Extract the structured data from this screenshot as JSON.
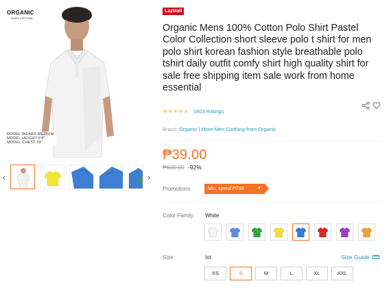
{
  "gallery": {
    "brand_logo": "ORGANIC",
    "brand_logo_sub": "100% COTTON",
    "model_info": [
      "MODEL WEARS MEDIUM",
      "MODEL HEIGHT 5'8\"",
      "MODEL CHEST 39\""
    ],
    "prev_arrow": "‹",
    "next_arrow": "›",
    "thumbnails": [
      {
        "color": "#f4f4f4",
        "active": true
      },
      {
        "color": "#f2e634",
        "active": false
      },
      {
        "color": "#3f7fd1",
        "active": false
      },
      {
        "color": "#3f7fd1",
        "active": false
      },
      {
        "color": "#3f7fd1",
        "active": false
      }
    ]
  },
  "product": {
    "badge": "LazMall",
    "title": "Organic Mens 100% Cotton Polo Shirt Pastel Color Collection short sleeve polo t shirt for men polo shirt korean fashion style breathable polo tshirt daily outfit comfy shirt high quality shirt for sale free shipping item sale work from home essential",
    "rating_stars": 4.5,
    "ratings_text": "1603 Ratings",
    "brand_label": "Brand:",
    "brand_name": "Organic",
    "brand_more": "| More Men Clothing from Organic",
    "price": "₱39.00",
    "original_price": "₱600.00",
    "discount": "-92%"
  },
  "promotions": {
    "label": "Promotions",
    "badge": "Min. spend ₱299",
    "caret": "▼"
  },
  "color_family": {
    "label": "Color Family",
    "selected": "White",
    "swatches": [
      "#f4f4f4",
      "#5a8fd6",
      "#2faa3c",
      "#f0e03a",
      "#2f7fd8",
      "#d42a2a",
      "#9b3fc0",
      "#f0a030"
    ],
    "selected_index": 4
  },
  "size": {
    "label": "Size",
    "system": "Int",
    "guide": "Size Guide",
    "options": [
      "XS",
      "S",
      "M",
      "L",
      "XL",
      "XXL"
    ],
    "selected_index": 1
  },
  "colors": {
    "accent": "#f57224",
    "link": "#1a9cb7",
    "lazmall_red": "#d0011b",
    "star": "#faca51"
  }
}
